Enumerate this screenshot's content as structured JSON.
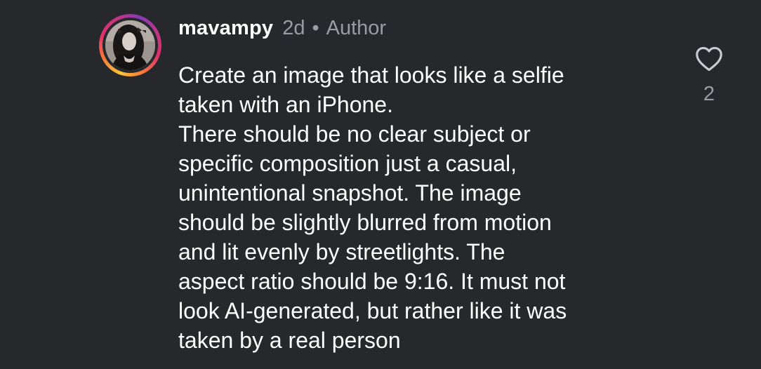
{
  "comment": {
    "avatar_icon": "user-avatar",
    "username": "mavampy",
    "time": "2d",
    "separator": "•",
    "role_badge": "Author",
    "lines": [
      "Create an image that looks like a selfie",
      "taken with an iPhone.",
      "There should be no clear subject or",
      "specific composition just a casual,",
      "unintentional snapshot. The image",
      "should be slightly blurred from motion",
      "and lit evenly by streetlights. The",
      "aspect ratio should be 9:16. It must not",
      "look AI-generated, but rather like it was",
      "taken by a real person"
    ],
    "like_icon": "heart-icon",
    "like_count": "2"
  },
  "colors": {
    "background": "#27282c",
    "primary_text": "#ffffff",
    "secondary_text": "#9a9ca3",
    "story_ring": [
      "#f9c23c",
      "#f77737",
      "#e1306c",
      "#c13584",
      "#833ab4"
    ]
  }
}
